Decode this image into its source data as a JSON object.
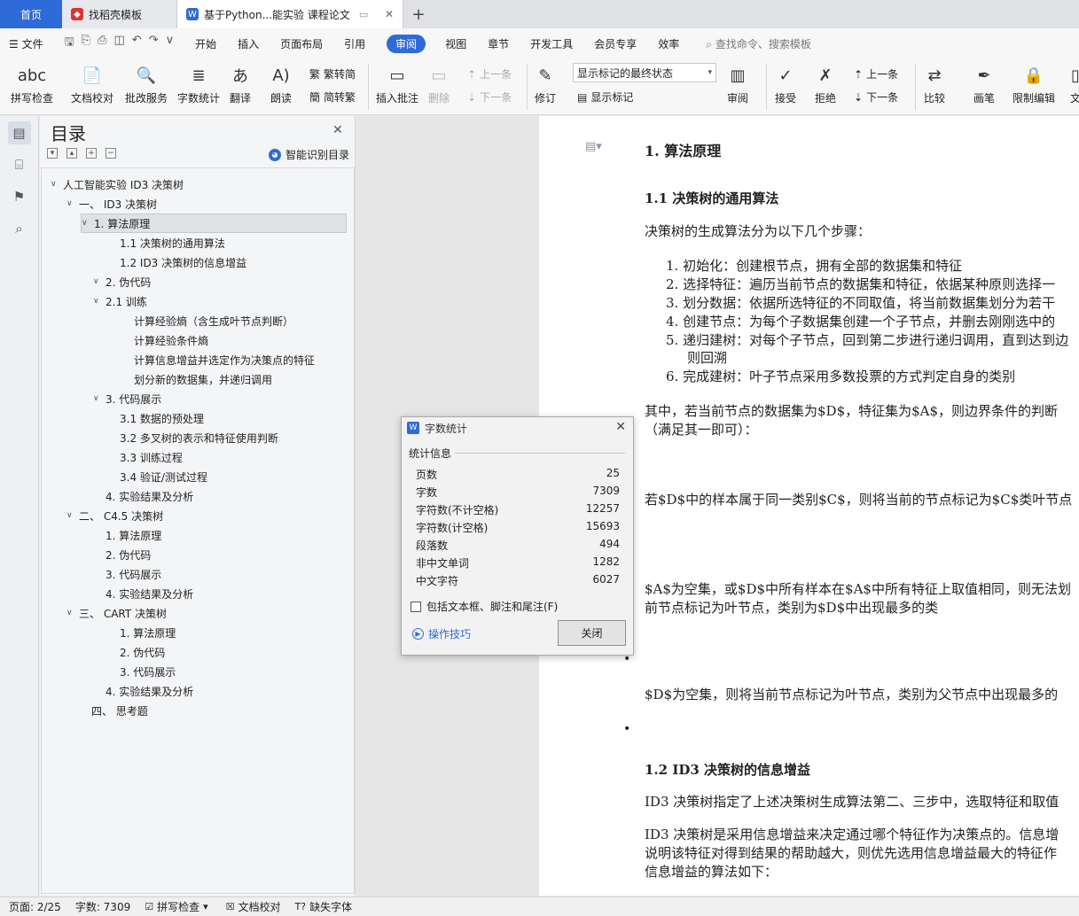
{
  "tabs": {
    "home": "首页",
    "templates": "找稻壳模板",
    "document": "基于Python...能实验 课程论文"
  },
  "menu": {
    "file": "文件",
    "items": [
      "开始",
      "插入",
      "页面布局",
      "引用",
      "审阅",
      "视图",
      "章节",
      "开发工具",
      "会员专享",
      "效率"
    ],
    "active": "审阅",
    "search_placeholder": "查找命令、搜索模板"
  },
  "ribbon": {
    "spellcheck": "拼写检查",
    "doc_proof": "文档校对",
    "batch_service": "批改服务",
    "word_count": "字数统计",
    "translate": "翻译",
    "read_aloud": "朗读",
    "trad_to_simp": "繁转简",
    "simp_to_trad": "简转繁",
    "insert_comment": "插入批注",
    "delete": "删除",
    "prev": "上一条",
    "next": "下一条",
    "track_changes": "修订",
    "markup_state": "显示标记的最终状态",
    "show_markup": "显示标记",
    "review": "审阅",
    "accept": "接受",
    "reject": "拒绝",
    "prev2": "上一条",
    "next2": "下一条",
    "compare": "比较",
    "pen": "画笔",
    "restrict_edit": "限制编辑",
    "doc_trunc": "文"
  },
  "toc": {
    "title": "目录",
    "smart": "智能识别目录",
    "items": [
      {
        "label": "人工智能实验 ID3 决策树",
        "caret": "∨"
      },
      {
        "label": "一、  ID3 决策树",
        "caret": "∨"
      },
      {
        "label": "1. 算法原理",
        "caret": "∨"
      },
      {
        "label": "1.1 决策树的通用算法",
        "caret": ""
      },
      {
        "label": "1.2 ID3 决策树的信息增益",
        "caret": ""
      },
      {
        "label": "2. 伪代码",
        "caret": "∨"
      },
      {
        "label": "2.1 训练",
        "caret": "∨"
      },
      {
        "label": "计算经验熵（含生成叶节点判断）",
        "caret": ""
      },
      {
        "label": "计算经验条件熵",
        "caret": ""
      },
      {
        "label": "计算信息增益并选定作为决策点的特征",
        "caret": ""
      },
      {
        "label": "划分新的数据集，并递归调用",
        "caret": ""
      },
      {
        "label": "3. 代码展示",
        "caret": "∨"
      },
      {
        "label": "3.1 数据的预处理",
        "caret": ""
      },
      {
        "label": "3.2 多叉树的表示和特征使用判断",
        "caret": ""
      },
      {
        "label": "3.3 训练过程",
        "caret": ""
      },
      {
        "label": "3.4 验证/测试过程",
        "caret": ""
      },
      {
        "label": "4. 实验结果及分析",
        "caret": ""
      },
      {
        "label": "二、  C4.5 决策树",
        "caret": "∨"
      },
      {
        "label": "1. 算法原理",
        "caret": ""
      },
      {
        "label": "2. 伪代码",
        "caret": ""
      },
      {
        "label": "3. 代码展示",
        "caret": ""
      },
      {
        "label": "4. 实验结果及分析",
        "caret": ""
      },
      {
        "label": "三、  CART 决策树",
        "caret": "∨"
      },
      {
        "label": "1. 算法原理",
        "caret": ""
      },
      {
        "label": "2. 伪代码",
        "caret": ""
      },
      {
        "label": "3. 代码展示",
        "caret": ""
      },
      {
        "label": "4. 实验结果及分析",
        "caret": ""
      },
      {
        "label": "四、  思考题",
        "caret": ""
      }
    ]
  },
  "doc": {
    "h1": "1.  算法原理",
    "h2a": "1.1  决策树的通用算法",
    "intro": "决策树的生成算法分为以下几个步骤：",
    "steps": [
      "1.   初始化：创建根节点，拥有全部的数据集和特征",
      "2.   选择特征：遍历当前节点的数据集和特征，依据某种原则选择一",
      "3.   划分数据：依据所选特征的不同取值，将当前数据集划分为若干",
      "4.   创建节点：为每个子数据集创建一个子节点，并删去刚刚选中的",
      "5.   递归建树：对每个子节点，回到第二步进行递归调用，直到达到边",
      "则回溯",
      "6.   完成建树：叶子节点采用多数投票的方式判定自身的类别"
    ],
    "p1": "其中，若当前节点的数据集为$D$，特征集为$A$，则边界条件的判断",
    "p1b": "（满足其一即可）：",
    "p2": "若$D$中的样本属于同一类别$C$，则将当前的节点标记为$C$类叶节点",
    "p3": "$A$为空集，或$D$中所有样本在$A$中所有特征上取值相同，则无法划",
    "p3b": "前节点标记为叶节点，类别为$D$中出现最多的类",
    "p4": "$D$为空集，则将当前节点标记为叶节点，类别为父节点中出现最多的",
    "h2b": "1.2 ID3 决策树的信息增益",
    "p5": "ID3 决策树指定了上述决策树生成算法第二、三步中，选取特征和取值",
    "p6": "ID3 决策树是采用信息增益来决定通过哪个特征作为决策点的。信息增",
    "p6b": "说明该特征对得到结果的帮助越大，则优先选用信息增益最大的特征作",
    "p6c": "信息增益的算法如下："
  },
  "dialog": {
    "title": "字数统计",
    "section": "统计信息",
    "stats": [
      {
        "label": "页数",
        "value": "25"
      },
      {
        "label": "字数",
        "value": "7309"
      },
      {
        "label": "字符数(不计空格)",
        "value": "12257"
      },
      {
        "label": "字符数(计空格)",
        "value": "15693"
      },
      {
        "label": "段落数",
        "value": "494"
      },
      {
        "label": "非中文单词",
        "value": "1282"
      },
      {
        "label": "中文字符",
        "value": "6027"
      }
    ],
    "checkbox": "包括文本框、脚注和尾注(F)",
    "tips": "操作技巧",
    "close": "关闭"
  },
  "status": {
    "page": "页面: 2/25",
    "words": "字数: 7309",
    "spell": "拼写检查",
    "proof": "文档校对",
    "missing_font": "缺失字体"
  }
}
